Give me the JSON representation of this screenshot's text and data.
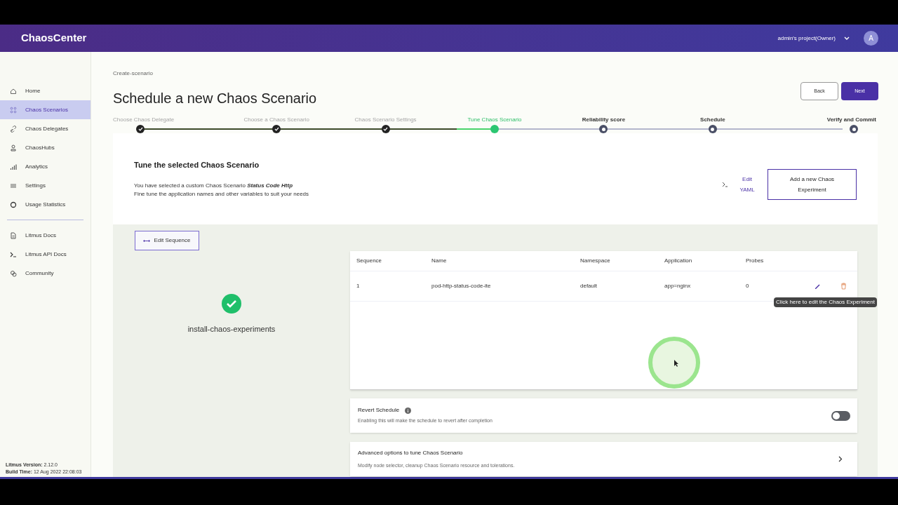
{
  "header": {
    "logo": "ChaosCenter",
    "project": "admin's project(Owner)",
    "avatar": "A"
  },
  "sidebar": {
    "items": [
      {
        "label": "Home",
        "selected": false
      },
      {
        "label": "Chaos Scenarios",
        "selected": true
      },
      {
        "label": "Chaos Delegates",
        "selected": false
      },
      {
        "label": "ChaosHubs",
        "selected": false
      },
      {
        "label": "Analytics",
        "selected": false
      },
      {
        "label": "Settings",
        "selected": false
      },
      {
        "label": "Usage Statistics",
        "selected": false
      }
    ],
    "links": [
      {
        "label": "Litmus Docs"
      },
      {
        "label": "Litmus API Docs"
      },
      {
        "label": "Community"
      }
    ],
    "version": "**Litmus Version:** 2.12.0",
    "build": "**Build Time:** 12 Aug 2022 22:08:03"
  },
  "breadcrumb": "Create-scenario",
  "title": "Schedule a new Chaos Scenario",
  "buttons": {
    "back": "Back",
    "next": "Next"
  },
  "steps": [
    {
      "label": "Choose Chaos Delegate",
      "kind": "done"
    },
    {
      "label": "Choose a Chaos Scenario",
      "kind": "done"
    },
    {
      "label": "Chaos Scenario Settings",
      "kind": "done"
    },
    {
      "label": "Tune Chaos Scenario",
      "kind": "current"
    },
    {
      "label": "Reliability score",
      "kind": "pending"
    },
    {
      "label": "Schedule",
      "kind": "pending"
    },
    {
      "label": "Verify and Commit",
      "kind": "pending"
    }
  ],
  "tune": {
    "heading": "Tune the selected Chaos Scenario",
    "line1": "You have selected a custom Chaos Scenario **Status Code Http**",
    "line2": "Fine tune the application names and other variables to suit your needs",
    "edit_yaml": "Edit YAML",
    "add_experiment": "Add a new Chaos Experiment"
  },
  "edit_sequence": "Edit Sequence",
  "workflow_node": "install-chaos-experiments",
  "table": {
    "columns": [
      "Sequence",
      "Name",
      "Namespace",
      "Application",
      "Probes"
    ],
    "rows": [
      {
        "cells": [
          "1",
          "pod-http-status-code-ite",
          "default",
          "app=nginx",
          "0"
        ]
      }
    ],
    "tooltip": "Click here to edit the Chaos Experiment"
  },
  "revert": {
    "title": "Revert Schedule",
    "description": "Enabling this will make the schedule to revert after completion",
    "on": false
  },
  "advanced": {
    "title": "Advanced options to tune Chaos Scenario",
    "description": "Modify node selector, cleanup Chaos Scenario resource and tolerations."
  }
}
